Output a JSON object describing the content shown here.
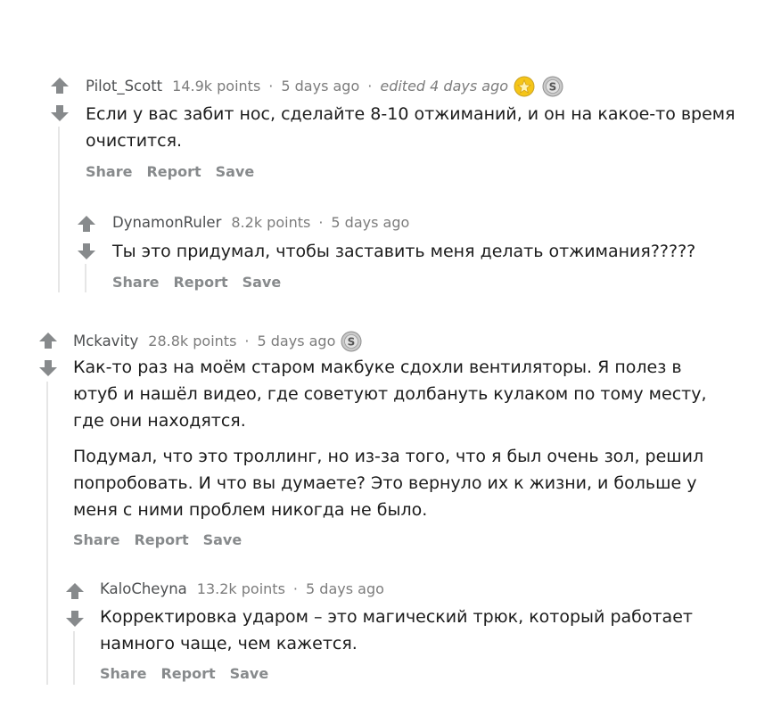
{
  "comments": [
    {
      "author": "Pilot_Scott",
      "points": "14.9k points",
      "time": "5 days ago",
      "edited": "edited 4 days ago",
      "text": "Если у вас забит нос, сделайте 8-10 отжиманий, и он на какое-то время очистится.",
      "actions": [
        "Share",
        "Report",
        "Save"
      ],
      "awards": [
        "gold-award-icon",
        "silver-award-icon"
      ]
    },
    {
      "author": "DynamonRuler",
      "points": "8.2k points",
      "time": "5 days ago",
      "text": "Ты это придумал, чтобы заставить меня делать отжимания?????",
      "actions": [
        "Share",
        "Report",
        "Save"
      ]
    },
    {
      "author": "Mckavity",
      "points": "28.8k points",
      "time": "5 days ago",
      "paragraphs": [
        "Как-то раз на моём старом макбуке сдохли вентиляторы. Я полез в ютуб и нашёл видео, где советуют долбануть кулаком по тому месту, где они находятся.",
        "Подумал, что это троллинг, но из-за того, что я был очень зол, решил попробовать. И что вы думаете? Это вернуло их к жизни, и больше у меня с ними проблем никогда не было."
      ],
      "actions": [
        "Share",
        "Report",
        "Save"
      ],
      "awards": [
        "silver-award-icon"
      ]
    },
    {
      "author": "KaloCheyna",
      "points": "13.2k points",
      "time": "5 days ago",
      "text": "Корректировка ударом – это магический трюк, который работает намного чаще, чем кажется.",
      "actions": [
        "Share",
        "Report",
        "Save"
      ]
    }
  ],
  "colors": {
    "arrow": "#878a8c",
    "meta": "#7c7c7c",
    "text": "#1c1c1c",
    "thread_line": "#e6e6e6",
    "gold": "#f5c518"
  }
}
